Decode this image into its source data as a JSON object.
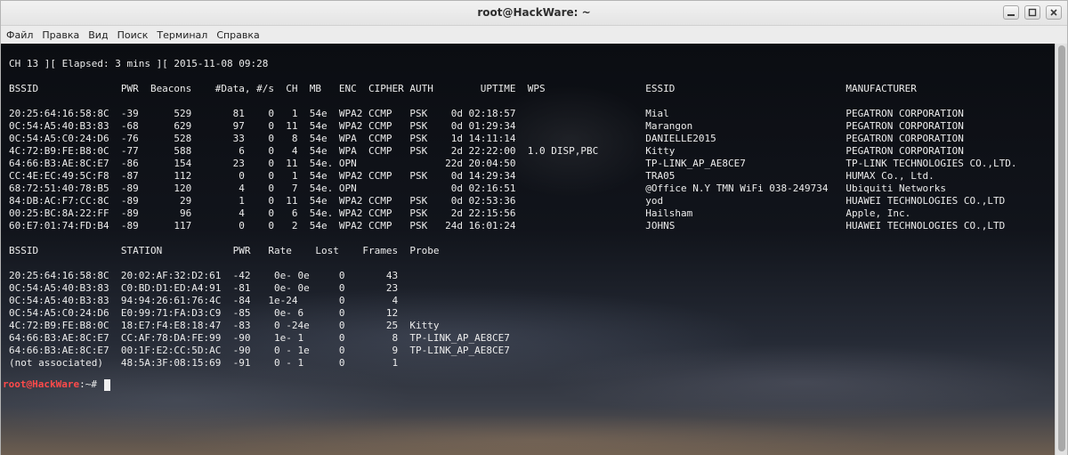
{
  "window": {
    "title": "root@HackWare: ~"
  },
  "menu": [
    "Файл",
    "Правка",
    "Вид",
    "Поиск",
    "Терминал",
    "Справка"
  ],
  "terminal": {
    "lines": [
      "CH 13 ][ Elapsed: 3 mins ][ 2015-11-08 09:28",
      "",
      "BSSID              PWR  Beacons    #Data, #/s  CH  MB   ENC  CIPHER AUTH        UPTIME  WPS                 ESSID                             MANUFACTURER",
      "",
      "20:25:64:16:58:8C  -39      529       81    0   1  54e  WPA2 CCMP   PSK    0d 02:18:57                      Mial                              PEGATRON CORPORATION",
      "0C:54:A5:40:B3:83  -68      629       97    0  11  54e  WPA2 CCMP   PSK    0d 01:29:34                      Marangon                          PEGATRON CORPORATION",
      "0C:54:A5:C0:24:D6  -76      528       33    0   8  54e  WPA  CCMP   PSK    1d 14:11:14                      DANIELLE2015                      PEGATRON CORPORATION",
      "4C:72:B9:FE:B8:0C  -77      588        6    0   4  54e  WPA  CCMP   PSK    2d 22:22:00  1.0 DISP,PBC        Kitty                             PEGATRON CORPORATION",
      "64:66:B3:AE:8C:E7  -86      154       23    0  11  54e. OPN               22d 20:04:50                      TP-LINK_AP_AE8CE7                 TP-LINK TECHNOLOGIES CO.,LTD.",
      "CC:4E:EC:49:5C:F8  -87      112        0    0   1  54e  WPA2 CCMP   PSK    0d 14:29:34                      TRA05                             HUMAX Co., Ltd.",
      "68:72:51:40:78:B5  -89      120        4    0   7  54e. OPN                0d 02:16:51                      @Office N.Y TMN WiFi 038-249734   Ubiquiti Networks",
      "84:DB:AC:F7:CC:8C  -89       29        1    0  11  54e  WPA2 CCMP   PSK    0d 02:53:36                      yod                               HUAWEI TECHNOLOGIES CO.,LTD",
      "00:25:BC:8A:22:FF  -89       96        4    0   6  54e. WPA2 CCMP   PSK    2d 22:15:56                      Hailsham                          Apple, Inc.",
      "60:E7:01:74:FD:B4  -89      117        0    0   2  54e  WPA2 CCMP   PSK   24d 16:01:24                      JOHNS                             HUAWEI TECHNOLOGIES CO.,LTD",
      "",
      "BSSID              STATION            PWR   Rate    Lost    Frames  Probe",
      "",
      "20:25:64:16:58:8C  20:02:AF:32:D2:61  -42    0e- 0e     0       43",
      "0C:54:A5:40:B3:83  C0:BD:D1:ED:A4:91  -81    0e- 0e     0       23",
      "0C:54:A5:40:B3:83  94:94:26:61:76:4C  -84   1e-24       0        4",
      "0C:54:A5:C0:24:D6  E0:99:71:FA:D3:C9  -85    0e- 6      0       12",
      "4C:72:B9:FE:B8:0C  18:E7:F4:E8:18:47  -83    0 -24e     0       25  Kitty",
      "64:66:B3:AE:8C:E7  CC:AF:78:DA:FE:99  -90    1e- 1      0        8  TP-LINK_AP_AE8CE7",
      "64:66:B3:AE:8C:E7  00:1F:E2:CC:5D:AC  -90    0 - 1e     0        9  TP-LINK_AP_AE8CE7",
      "(not associated)   48:5A:3F:08:15:69  -91    0 - 1      0        1"
    ],
    "prompt_user": "root@HackWare",
    "prompt_path": ":~# "
  }
}
